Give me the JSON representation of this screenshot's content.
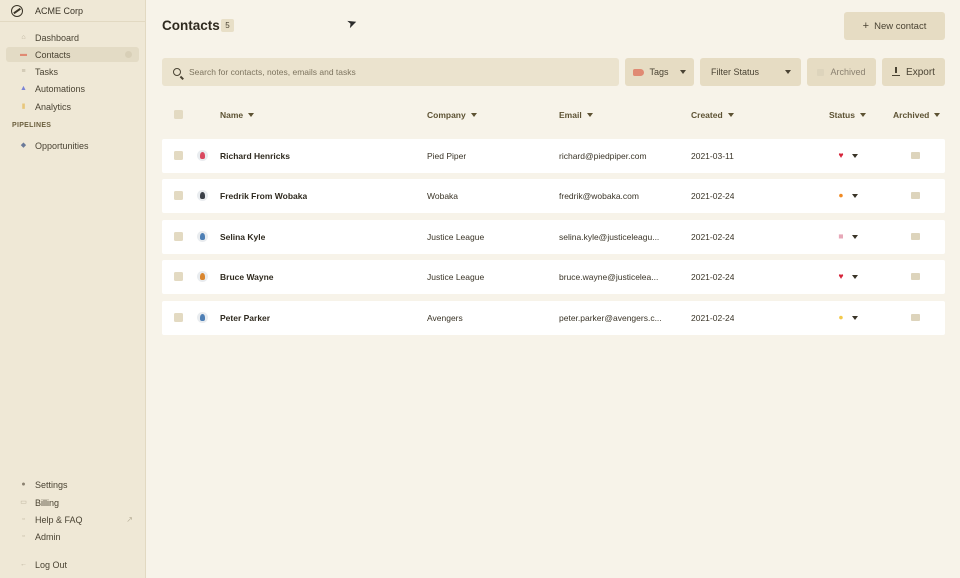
{
  "brand": {
    "name": "ACME Corp"
  },
  "sidebar": {
    "nav": [
      {
        "label": "Dashboard",
        "icon": "home-icon"
      },
      {
        "label": "Contacts",
        "icon": "contact-card-icon",
        "active": true
      },
      {
        "label": "Tasks",
        "icon": "checklist-icon"
      },
      {
        "label": "Automations",
        "icon": "lightning-icon"
      },
      {
        "label": "Analytics",
        "icon": "chart-icon"
      }
    ],
    "section_label": "PIPELINES",
    "pipelines": [
      {
        "label": "Opportunities",
        "icon": "layers-icon"
      }
    ],
    "bottom": [
      {
        "label": "Settings",
        "icon": "user-avatar-icon"
      },
      {
        "label": "Billing",
        "icon": "credit-card-icon"
      },
      {
        "label": "Help & FAQ",
        "icon": "help-icon",
        "external": true
      },
      {
        "label": "Admin",
        "icon": "shield-icon"
      },
      {
        "label": "Log Out",
        "icon": "logout-icon"
      }
    ]
  },
  "header": {
    "title": "Contacts",
    "count": "5",
    "new_button": "New contact",
    "new_button_icon": "+"
  },
  "toolbar": {
    "search_placeholder": "Search for contacts, notes, emails and tasks",
    "tags_label": "Tags",
    "filter_label": "Filter Status",
    "archived_label": "Archived",
    "export_label": "Export"
  },
  "table": {
    "columns": [
      "Name",
      "Company",
      "Email",
      "Created",
      "Status",
      "Archived"
    ],
    "rows": [
      {
        "name": "Richard Henricks",
        "company": "Pied Piper",
        "email": "richard@piedpiper.com",
        "created": "2021-03-11",
        "status_icon": "heart-icon",
        "status_glyph": "♥",
        "status_color": "#d6243a",
        "avatar_color": "#d9485f"
      },
      {
        "name": "Fredrik From Wobaka",
        "company": "Wobaka",
        "email": "fredrik@wobaka.com",
        "created": "2021-02-24",
        "status_icon": "fire-icon",
        "status_glyph": "●",
        "status_color": "#f08a24",
        "avatar_color": "#3a3f47"
      },
      {
        "name": "Selina Kyle",
        "company": "Justice League",
        "email": "selina.kyle@justiceleagu...",
        "created": "2021-02-24",
        "status_icon": "flag-icon",
        "status_glyph": "■",
        "status_color": "#e7a8b8",
        "avatar_color": "#4e7fb5"
      },
      {
        "name": "Bruce Wayne",
        "company": "Justice League",
        "email": "bruce.wayne@justicelea...",
        "created": "2021-02-24",
        "status_icon": "heart-icon",
        "status_glyph": "♥",
        "status_color": "#d6243a",
        "avatar_color": "#d9862f"
      },
      {
        "name": "Peter Parker",
        "company": "Avengers",
        "email": "peter.parker@avengers.c...",
        "created": "2021-02-24",
        "status_icon": "wave-icon",
        "status_glyph": "●",
        "status_color": "#f2c94c",
        "avatar_color": "#4e7fb5"
      }
    ]
  }
}
